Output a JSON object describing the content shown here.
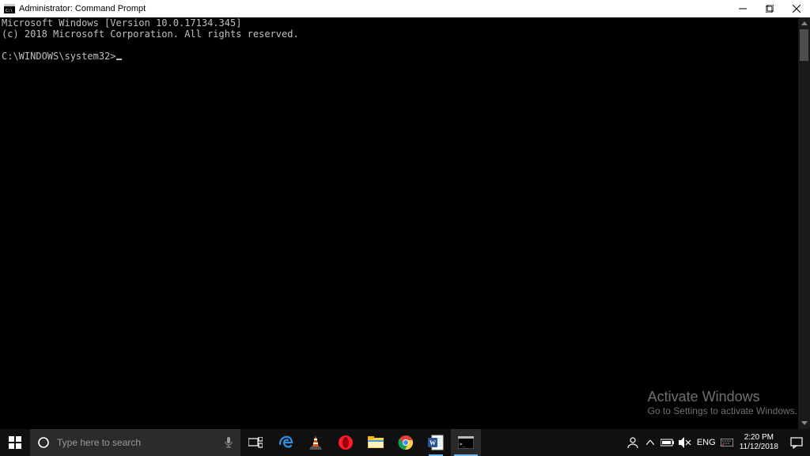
{
  "titlebar": {
    "title": "Administrator: Command Prompt"
  },
  "terminal": {
    "line1": "Microsoft Windows [Version 10.0.17134.345]",
    "line2": "(c) 2018 Microsoft Corporation. All rights reserved.",
    "prompt": "C:\\WINDOWS\\system32>"
  },
  "watermark": {
    "line1": "Activate Windows",
    "line2": "Go to Settings to activate Windows."
  },
  "taskbar": {
    "search_placeholder": "Type here to search",
    "language": "ENG",
    "clock": {
      "time": "2:20 PM",
      "date": "11/12/2018"
    }
  }
}
